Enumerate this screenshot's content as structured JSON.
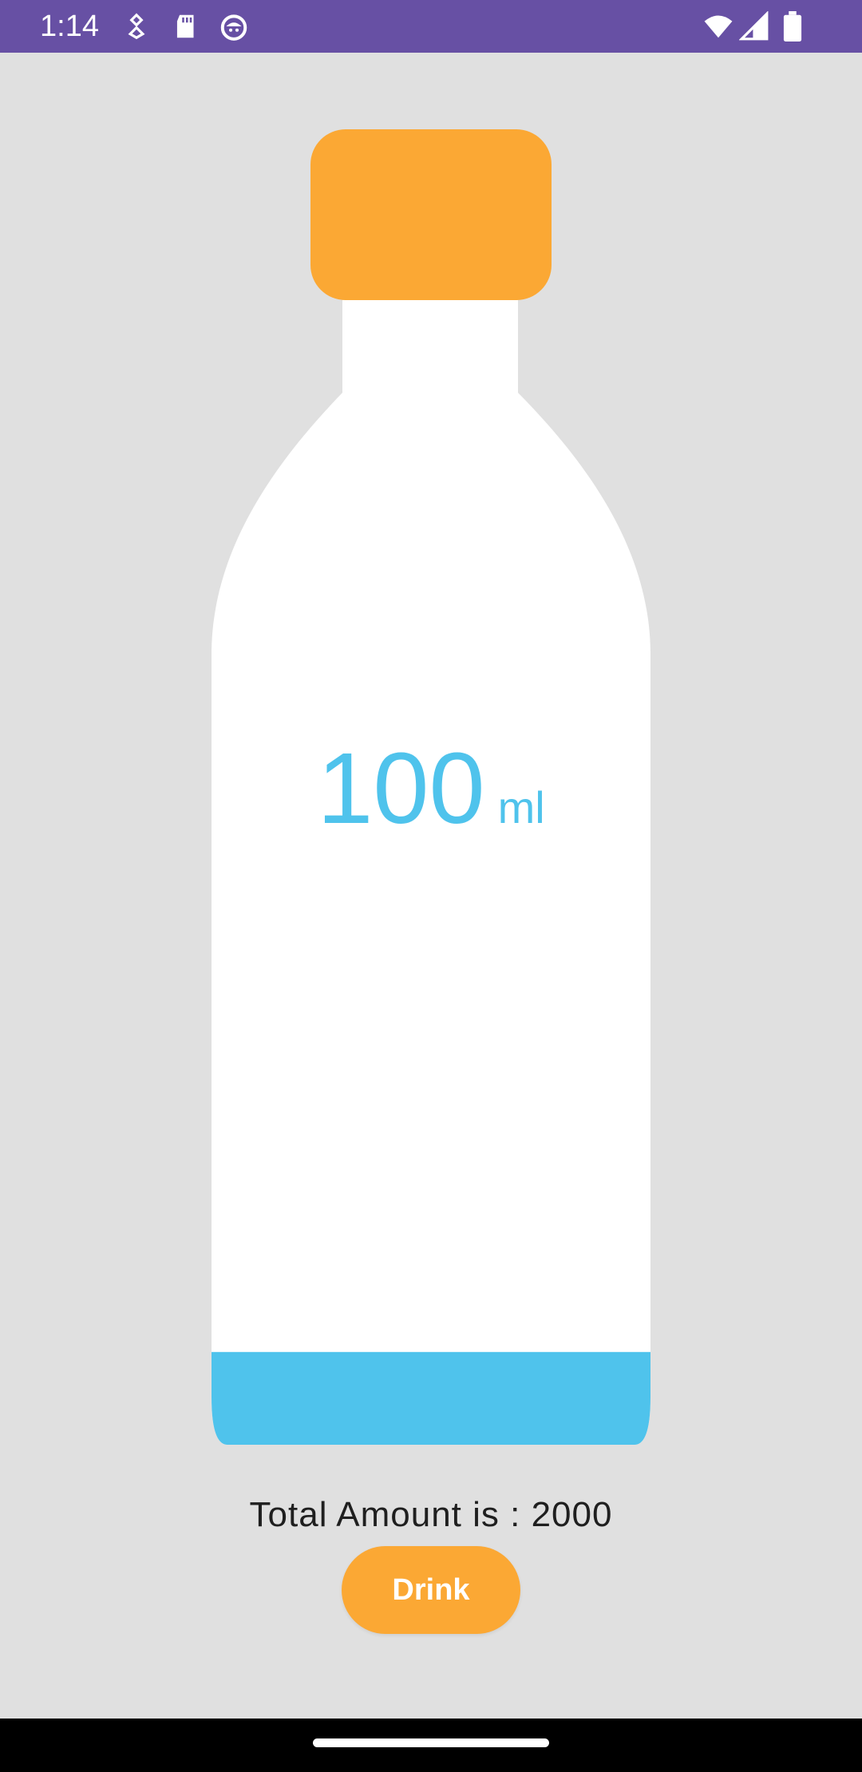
{
  "status_bar": {
    "time": "1:14",
    "background_color": "#6750a4",
    "left_icons": [
      "pin-icon",
      "sd-card-icon",
      "android-face-icon"
    ],
    "right_icons": [
      "wifi-icon",
      "cell-signal-icon",
      "battery-icon"
    ]
  },
  "bottle": {
    "amount": "100",
    "unit": "ml",
    "fill_fraction": 0.081,
    "cap_color": "#fba834",
    "body_color": "#ffffff",
    "water_color": "#4fc3ec"
  },
  "summary": {
    "total_text": "Total Amount is : 2000"
  },
  "actions": {
    "drink_label": "Drink"
  }
}
